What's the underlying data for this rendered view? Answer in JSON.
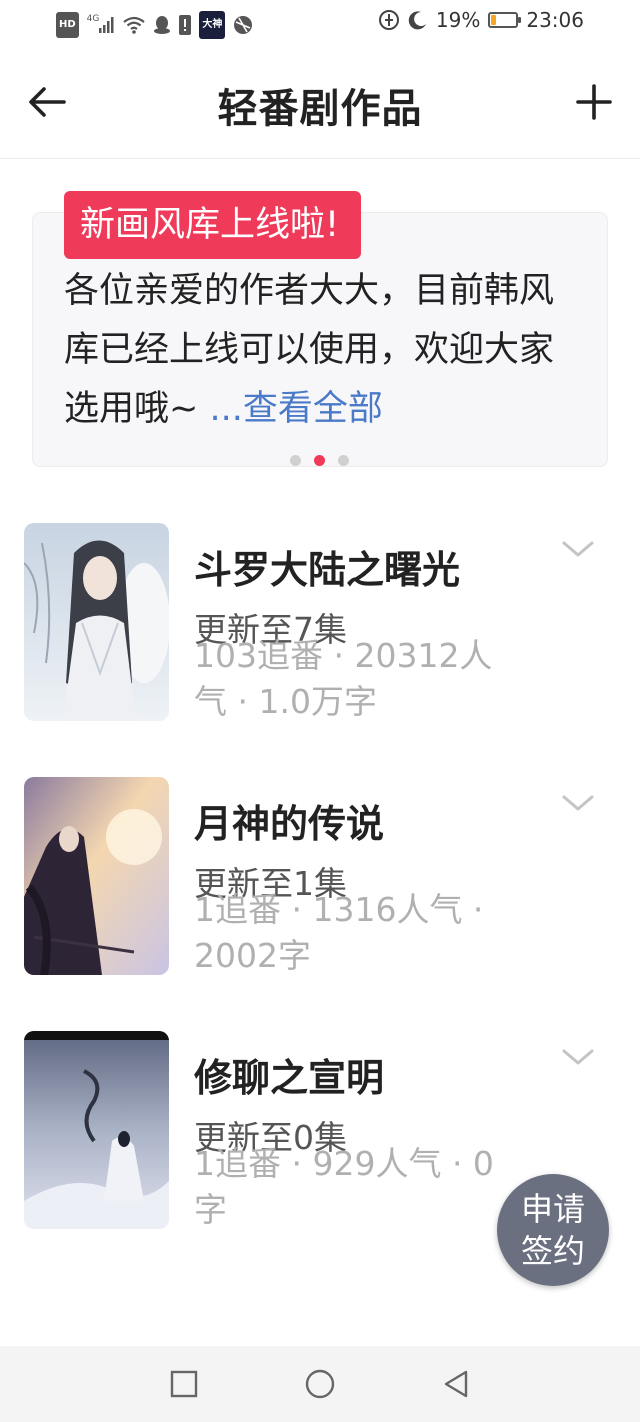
{
  "status_bar": {
    "hd": "HD",
    "network": "4G",
    "dashen": "大神",
    "battery_percent": "19%",
    "battery_level": 0.19,
    "time": "23:06"
  },
  "header": {
    "title": "轻番剧作品"
  },
  "notice": {
    "tag": "新画风库上线啦!",
    "body": "各位亲爱的作者大大，目前韩风库已经上线可以使用，欢迎大家选用哦~ ",
    "more": "...查看全部",
    "active_page": 1,
    "page_count": 3
  },
  "works": [
    {
      "title": "斗罗大陆之曙光",
      "update": "更新至7集",
      "stats": "103追番 · 20312人气 · 1.0万字"
    },
    {
      "title": "月神的传说",
      "update": "更新至1集",
      "stats": "1追番 · 1316人气 · 2002字"
    },
    {
      "title": "修聊之宣明",
      "update": "更新至0集",
      "stats": "1追番 · 929人气 · 0字"
    }
  ],
  "fab": {
    "line1": "申请",
    "line2": "签约"
  },
  "colors": {
    "accent": "#f03a5a",
    "link": "#4a7ac8",
    "fab": "#6b7080"
  }
}
